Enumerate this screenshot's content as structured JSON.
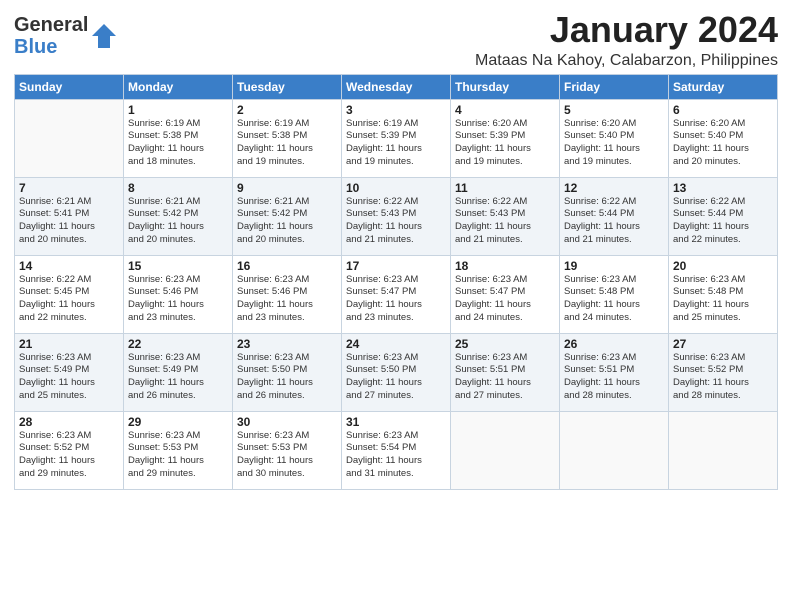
{
  "app": {
    "logo_general": "General",
    "logo_blue": "Blue"
  },
  "header": {
    "month": "January 2024",
    "location": "Mataas Na Kahoy, Calabarzon, Philippines"
  },
  "days_of_week": [
    "Sunday",
    "Monday",
    "Tuesday",
    "Wednesday",
    "Thursday",
    "Friday",
    "Saturday"
  ],
  "weeks": [
    [
      {
        "day": "",
        "info": ""
      },
      {
        "day": "1",
        "info": "Sunrise: 6:19 AM\nSunset: 5:38 PM\nDaylight: 11 hours\nand 18 minutes."
      },
      {
        "day": "2",
        "info": "Sunrise: 6:19 AM\nSunset: 5:38 PM\nDaylight: 11 hours\nand 19 minutes."
      },
      {
        "day": "3",
        "info": "Sunrise: 6:19 AM\nSunset: 5:39 PM\nDaylight: 11 hours\nand 19 minutes."
      },
      {
        "day": "4",
        "info": "Sunrise: 6:20 AM\nSunset: 5:39 PM\nDaylight: 11 hours\nand 19 minutes."
      },
      {
        "day": "5",
        "info": "Sunrise: 6:20 AM\nSunset: 5:40 PM\nDaylight: 11 hours\nand 19 minutes."
      },
      {
        "day": "6",
        "info": "Sunrise: 6:20 AM\nSunset: 5:40 PM\nDaylight: 11 hours\nand 20 minutes."
      }
    ],
    [
      {
        "day": "7",
        "info": "Sunrise: 6:21 AM\nSunset: 5:41 PM\nDaylight: 11 hours\nand 20 minutes."
      },
      {
        "day": "8",
        "info": "Sunrise: 6:21 AM\nSunset: 5:42 PM\nDaylight: 11 hours\nand 20 minutes."
      },
      {
        "day": "9",
        "info": "Sunrise: 6:21 AM\nSunset: 5:42 PM\nDaylight: 11 hours\nand 20 minutes."
      },
      {
        "day": "10",
        "info": "Sunrise: 6:22 AM\nSunset: 5:43 PM\nDaylight: 11 hours\nand 21 minutes."
      },
      {
        "day": "11",
        "info": "Sunrise: 6:22 AM\nSunset: 5:43 PM\nDaylight: 11 hours\nand 21 minutes."
      },
      {
        "day": "12",
        "info": "Sunrise: 6:22 AM\nSunset: 5:44 PM\nDaylight: 11 hours\nand 21 minutes."
      },
      {
        "day": "13",
        "info": "Sunrise: 6:22 AM\nSunset: 5:44 PM\nDaylight: 11 hours\nand 22 minutes."
      }
    ],
    [
      {
        "day": "14",
        "info": "Sunrise: 6:22 AM\nSunset: 5:45 PM\nDaylight: 11 hours\nand 22 minutes."
      },
      {
        "day": "15",
        "info": "Sunrise: 6:23 AM\nSunset: 5:46 PM\nDaylight: 11 hours\nand 23 minutes."
      },
      {
        "day": "16",
        "info": "Sunrise: 6:23 AM\nSunset: 5:46 PM\nDaylight: 11 hours\nand 23 minutes."
      },
      {
        "day": "17",
        "info": "Sunrise: 6:23 AM\nSunset: 5:47 PM\nDaylight: 11 hours\nand 23 minutes."
      },
      {
        "day": "18",
        "info": "Sunrise: 6:23 AM\nSunset: 5:47 PM\nDaylight: 11 hours\nand 24 minutes."
      },
      {
        "day": "19",
        "info": "Sunrise: 6:23 AM\nSunset: 5:48 PM\nDaylight: 11 hours\nand 24 minutes."
      },
      {
        "day": "20",
        "info": "Sunrise: 6:23 AM\nSunset: 5:48 PM\nDaylight: 11 hours\nand 25 minutes."
      }
    ],
    [
      {
        "day": "21",
        "info": "Sunrise: 6:23 AM\nSunset: 5:49 PM\nDaylight: 11 hours\nand 25 minutes."
      },
      {
        "day": "22",
        "info": "Sunrise: 6:23 AM\nSunset: 5:49 PM\nDaylight: 11 hours\nand 26 minutes."
      },
      {
        "day": "23",
        "info": "Sunrise: 6:23 AM\nSunset: 5:50 PM\nDaylight: 11 hours\nand 26 minutes."
      },
      {
        "day": "24",
        "info": "Sunrise: 6:23 AM\nSunset: 5:50 PM\nDaylight: 11 hours\nand 27 minutes."
      },
      {
        "day": "25",
        "info": "Sunrise: 6:23 AM\nSunset: 5:51 PM\nDaylight: 11 hours\nand 27 minutes."
      },
      {
        "day": "26",
        "info": "Sunrise: 6:23 AM\nSunset: 5:51 PM\nDaylight: 11 hours\nand 28 minutes."
      },
      {
        "day": "27",
        "info": "Sunrise: 6:23 AM\nSunset: 5:52 PM\nDaylight: 11 hours\nand 28 minutes."
      }
    ],
    [
      {
        "day": "28",
        "info": "Sunrise: 6:23 AM\nSunset: 5:52 PM\nDaylight: 11 hours\nand 29 minutes."
      },
      {
        "day": "29",
        "info": "Sunrise: 6:23 AM\nSunset: 5:53 PM\nDaylight: 11 hours\nand 29 minutes."
      },
      {
        "day": "30",
        "info": "Sunrise: 6:23 AM\nSunset: 5:53 PM\nDaylight: 11 hours\nand 30 minutes."
      },
      {
        "day": "31",
        "info": "Sunrise: 6:23 AM\nSunset: 5:54 PM\nDaylight: 11 hours\nand 31 minutes."
      },
      {
        "day": "",
        "info": ""
      },
      {
        "day": "",
        "info": ""
      },
      {
        "day": "",
        "info": ""
      }
    ]
  ]
}
